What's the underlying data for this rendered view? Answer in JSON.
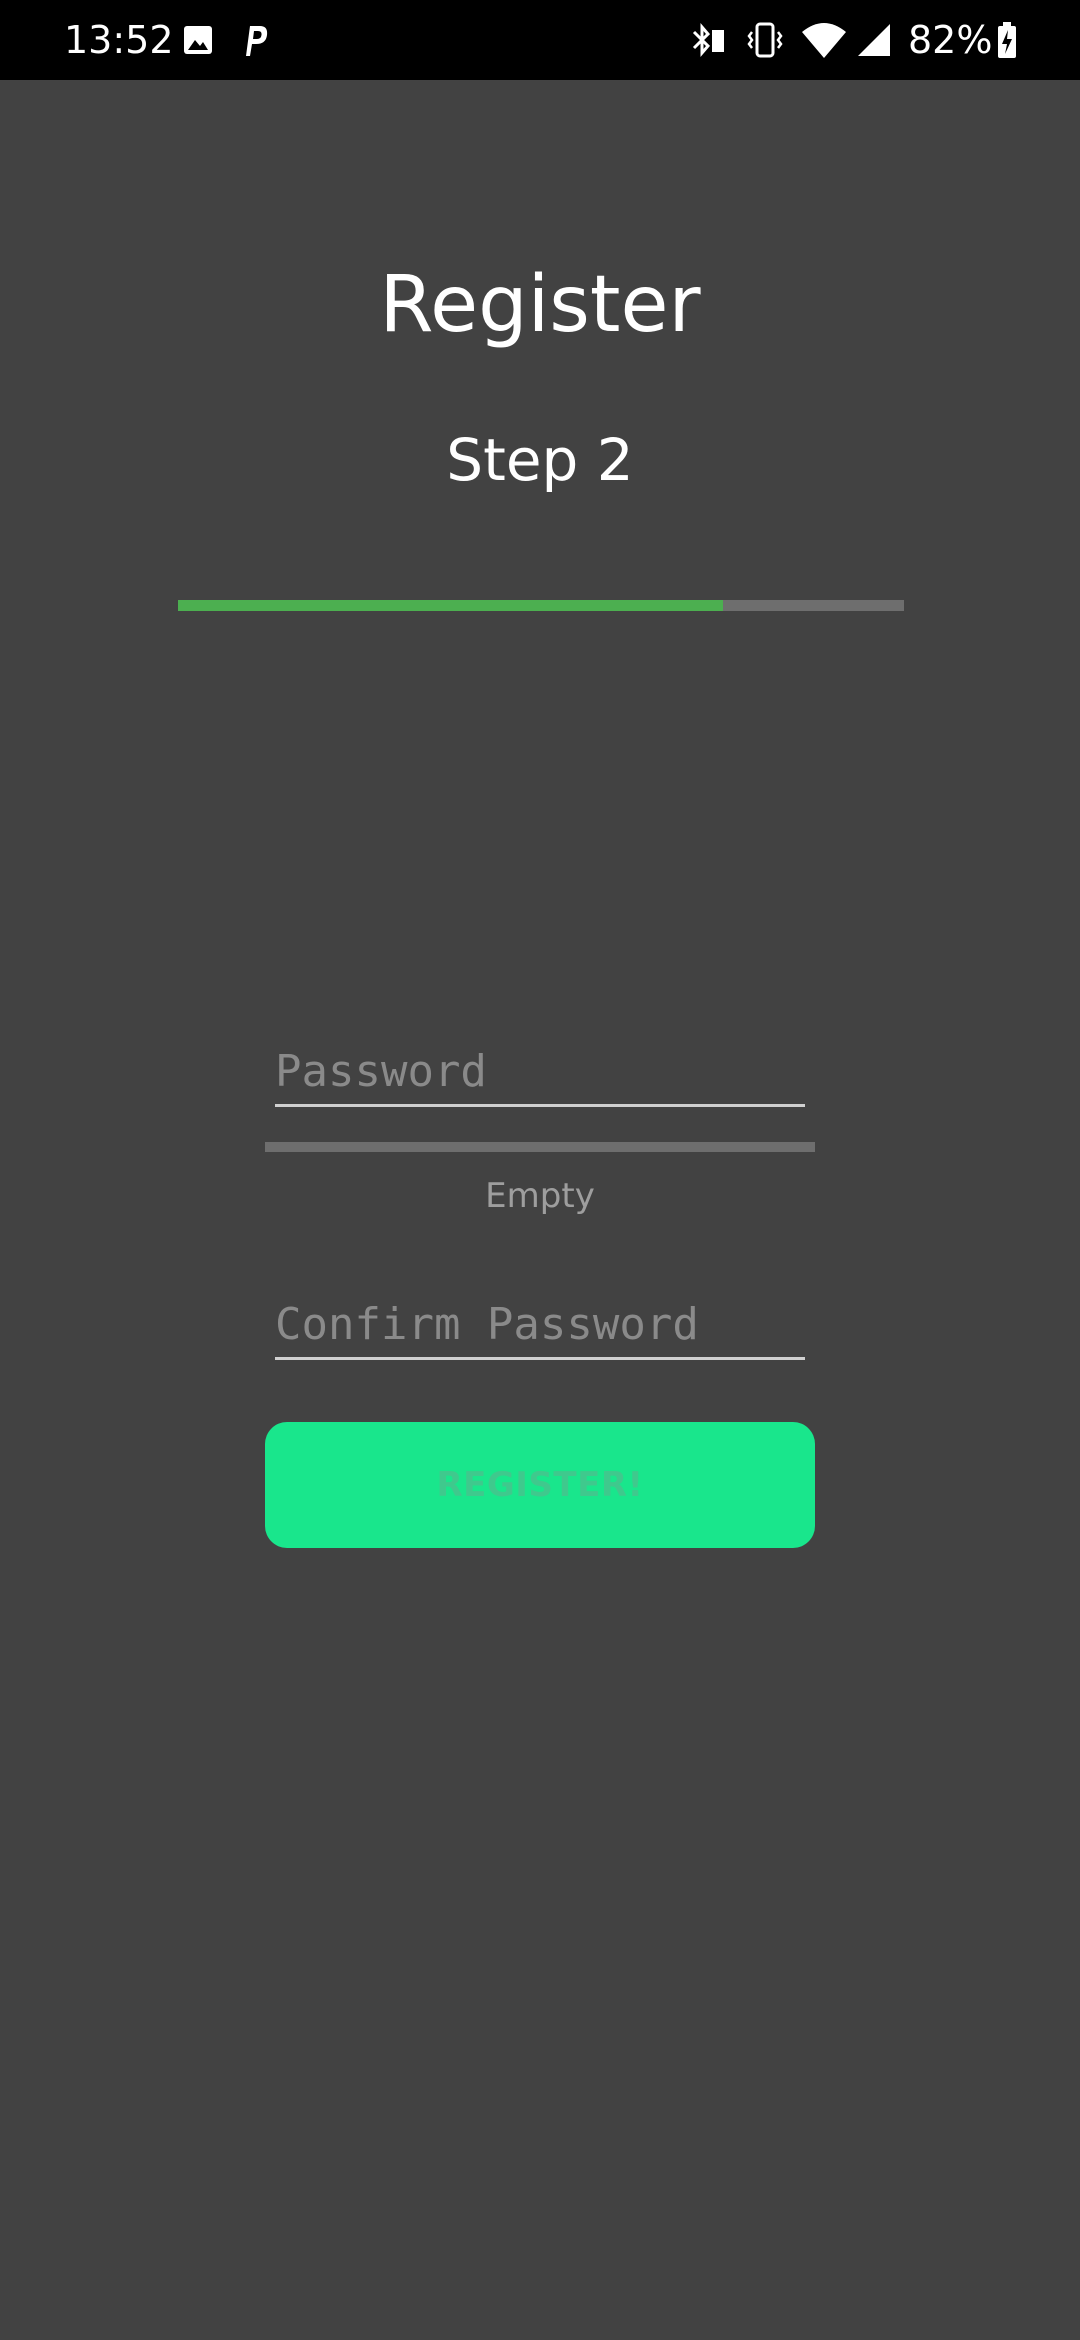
{
  "status_bar": {
    "time": "13:52",
    "battery_percent": "82%",
    "icons": [
      "image-notification-icon",
      "p-app-notification-icon",
      "bluetooth-icon",
      "vibrate-icon",
      "wifi-icon",
      "signal-icon",
      "battery-charging-icon"
    ]
  },
  "header": {
    "title": "Register",
    "step": "Step 2"
  },
  "progress": {
    "value_fraction": 0.75,
    "fill_color": "#4caf50",
    "track_color": "#6e6e6e"
  },
  "form": {
    "password_placeholder": "Password",
    "password_value": "",
    "strength_label": "Empty",
    "strength_fraction": 0,
    "confirm_placeholder": "Confirm Password",
    "confirm_value": "",
    "submit_label": "REGISTER!"
  },
  "colors": {
    "background": "#424242",
    "button": "#19e68c",
    "button_text": "#3fc98d"
  }
}
